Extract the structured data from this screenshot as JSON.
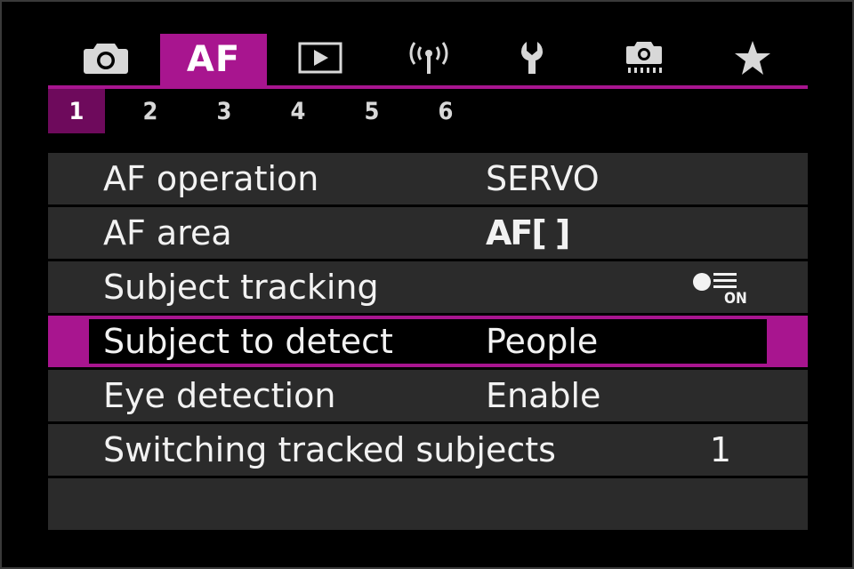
{
  "tabs": [
    {
      "name": "shooting",
      "icon": "camera-icon",
      "active": false
    },
    {
      "name": "af",
      "label": "AF",
      "active": true
    },
    {
      "name": "playback",
      "icon": "playback-icon",
      "active": false
    },
    {
      "name": "wireless",
      "icon": "wireless-icon",
      "active": false
    },
    {
      "name": "setup",
      "icon": "wrench-icon",
      "active": false
    },
    {
      "name": "custom-functions",
      "icon": "custom-camera-icon",
      "active": false
    },
    {
      "name": "my-menu",
      "icon": "star-icon",
      "active": false
    }
  ],
  "subtabs": [
    "1",
    "2",
    "3",
    "4",
    "5",
    "6"
  ],
  "active_subtab": "1",
  "menu": {
    "items": [
      {
        "label": "AF operation",
        "value": "SERVO"
      },
      {
        "label": "AF area",
        "value": "AF[ ]",
        "value_icon": "af-area-icon"
      },
      {
        "label": "Subject tracking",
        "value_icon": "tracking-on-icon"
      },
      {
        "label": "Subject to detect",
        "value": "People",
        "selected": true
      },
      {
        "label": "Eye detection",
        "value": "Enable"
      },
      {
        "label": "Switching tracked subjects",
        "value": "1"
      }
    ]
  },
  "colors": {
    "accent": "#a8158f",
    "row_bg": "#2b2b2b",
    "text": "#f2f2f2"
  }
}
